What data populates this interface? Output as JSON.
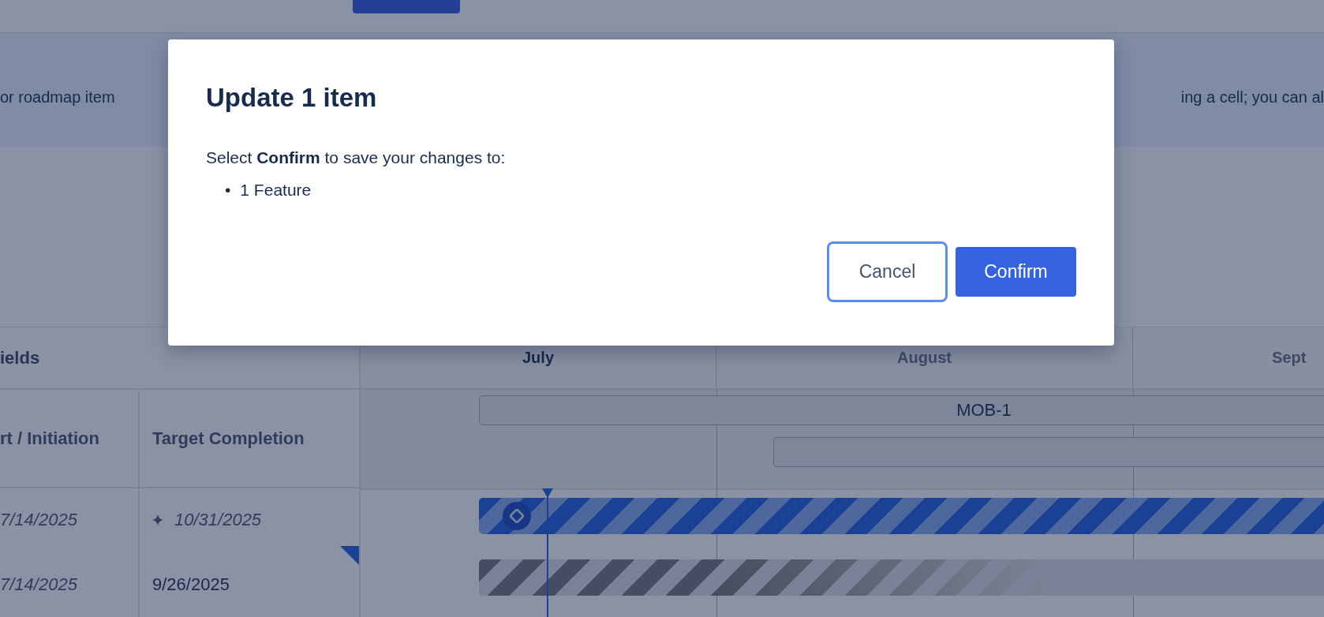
{
  "banner": {
    "text_left": "or roadmap item",
    "text_right": "ing a cell; you can al"
  },
  "roadmap": {
    "group_header": "ields",
    "columns": [
      "rt / Initiation",
      "Target Completion"
    ],
    "months": [
      {
        "label": "July",
        "current": true
      },
      {
        "label": "August",
        "current": false
      },
      {
        "label": "Sept",
        "current": false
      }
    ],
    "header_bar": {
      "label": "MOB-1"
    },
    "rows": [
      {
        "start": {
          "text": "7/14/2025",
          "italic": true
        },
        "target": {
          "text": "10/31/2025",
          "italic": true,
          "estimated": true
        },
        "edited": false,
        "bar": {
          "kind": "feature"
        }
      },
      {
        "start": {
          "text": "7/14/2025",
          "italic": true
        },
        "target": {
          "text": "9/26/2025",
          "italic": false,
          "estimated": false
        },
        "edited": true,
        "bar": {
          "kind": "plain"
        }
      }
    ]
  },
  "dialog": {
    "title": "Update 1 item",
    "message": "Select **Confirm** to save your changes to:",
    "items": [
      {
        "bullet": "•",
        "text": "1 Feature"
      }
    ],
    "buttons": [
      {
        "label": "Cancel",
        "kind": "secondary",
        "focused": true
      },
      {
        "label": "Confirm",
        "kind": "primary",
        "focused": false
      }
    ]
  }
}
